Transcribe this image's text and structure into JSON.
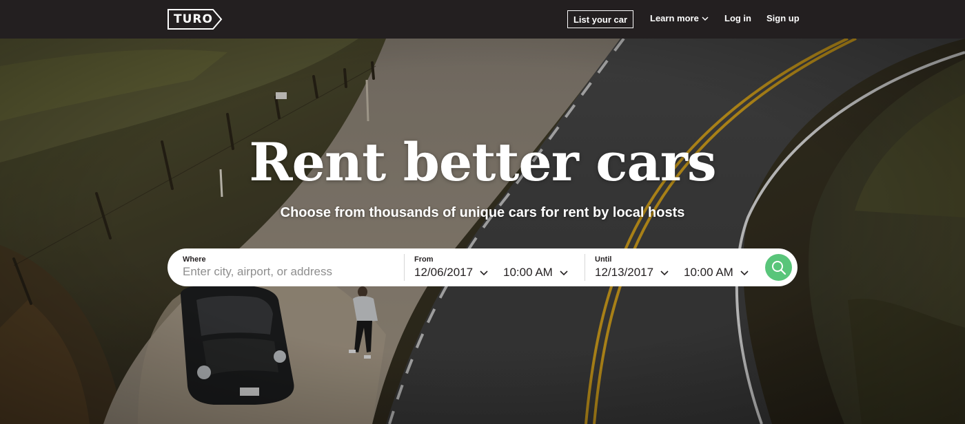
{
  "header": {
    "logo_text": "TURO",
    "nav": {
      "list_car": "List your car",
      "learn_more": "Learn more",
      "log_in": "Log in",
      "sign_up": "Sign up"
    }
  },
  "hero": {
    "title": "Rent better cars",
    "subtitle": "Choose from thousands of unique cars for rent by local hosts"
  },
  "search": {
    "where": {
      "label": "Where",
      "placeholder": "Enter city, airport, or address",
      "value": ""
    },
    "from": {
      "label": "From",
      "date": "12/06/2017",
      "time": "10:00 AM"
    },
    "until": {
      "label": "Until",
      "date": "12/13/2017",
      "time": "10:00 AM"
    },
    "submit_icon": "search-icon"
  },
  "colors": {
    "header_bg": "#231f20",
    "accent_green": "#59c57a",
    "text_white": "#ffffff"
  }
}
